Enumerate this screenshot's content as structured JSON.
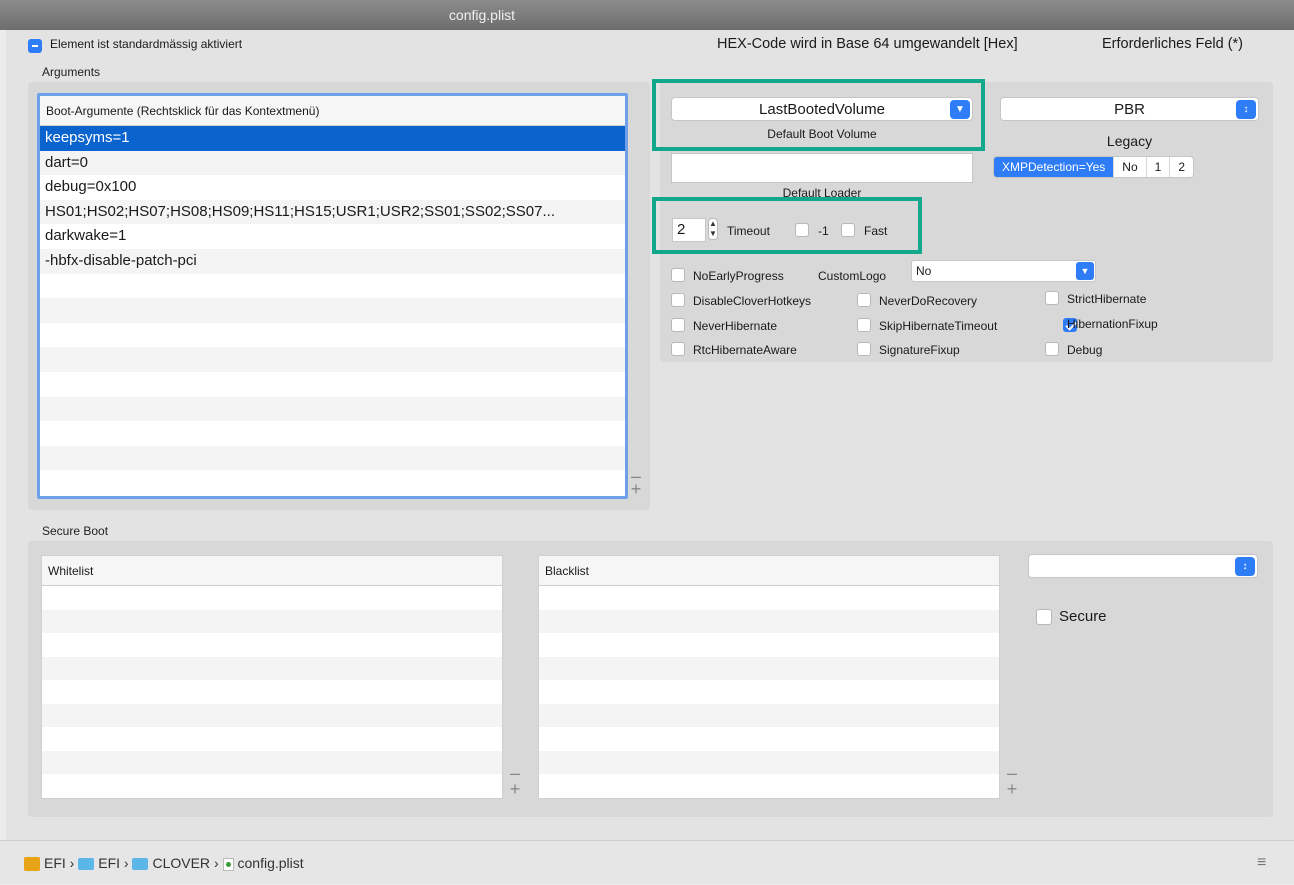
{
  "window": {
    "title": "config.plist"
  },
  "header": {
    "legend_default": "Element ist standardmässig aktiviert",
    "legend_hex": "HEX-Code wird in Base 64 umgewandelt [Hex]",
    "legend_required": "Erforderliches Feld (*)"
  },
  "arguments": {
    "section_label": "Arguments",
    "list_header": "Boot-Argumente (Rechtsklick für das Kontextmenü)",
    "items": [
      "keepsyms=1",
      "dart=0",
      "debug=0x100",
      "HS01;HS02;HS07;HS08;HS09;HS11;HS15;USR1;USR2;SS01;SS02;SS07...",
      "darkwake=1",
      "-hbfx-disable-patch-pci"
    ],
    "selected_index": 0
  },
  "boot": {
    "default_volume_value": "LastBootedVolume",
    "default_volume_label": "Default Boot Volume",
    "legacy_value": "PBR",
    "legacy_label": "Legacy",
    "default_loader_value": "",
    "default_loader_label": "Default Loader",
    "xmp_options": [
      "XMPDetection=Yes",
      "No",
      "1",
      "2"
    ],
    "xmp_selected": "XMPDetection=Yes",
    "timeout_value": "2",
    "timeout_label": "Timeout",
    "minus1_label": "-1",
    "fast_label": "Fast",
    "custom_logo_label": "CustomLogo",
    "custom_logo_value": "No",
    "flags": {
      "no_early_progress": {
        "label": "NoEarlyProgress",
        "checked": false
      },
      "disable_clover_hotkeys": {
        "label": "DisableCloverHotkeys",
        "checked": false
      },
      "never_do_recovery": {
        "label": "NeverDoRecovery",
        "checked": false
      },
      "strict_hibernate": {
        "label": "StrictHibernate",
        "checked": false
      },
      "never_hibernate": {
        "label": "NeverHibernate",
        "checked": false
      },
      "skip_hibernate_timeout": {
        "label": "SkipHibernateTimeout",
        "checked": false
      },
      "hibernation_fixup": {
        "label": "HibernationFixup",
        "checked": true
      },
      "rtc_hibernate_aware": {
        "label": "RtcHibernateAware",
        "checked": false
      },
      "signature_fixup": {
        "label": "SignatureFixup",
        "checked": false
      },
      "debug": {
        "label": "Debug",
        "checked": false
      }
    }
  },
  "secure_boot": {
    "section_label": "Secure Boot",
    "whitelist_header": "Whitelist",
    "blacklist_header": "Blacklist",
    "policy_value": "",
    "secure_label": "Secure"
  },
  "path_bar": {
    "items": [
      "EFI",
      "EFI",
      "CLOVER",
      "config.plist"
    ],
    "separator": "›"
  },
  "colors": {
    "accent": "#2e7cf6",
    "selection": "#0b63ce",
    "highlight_box": "#13a78b"
  }
}
